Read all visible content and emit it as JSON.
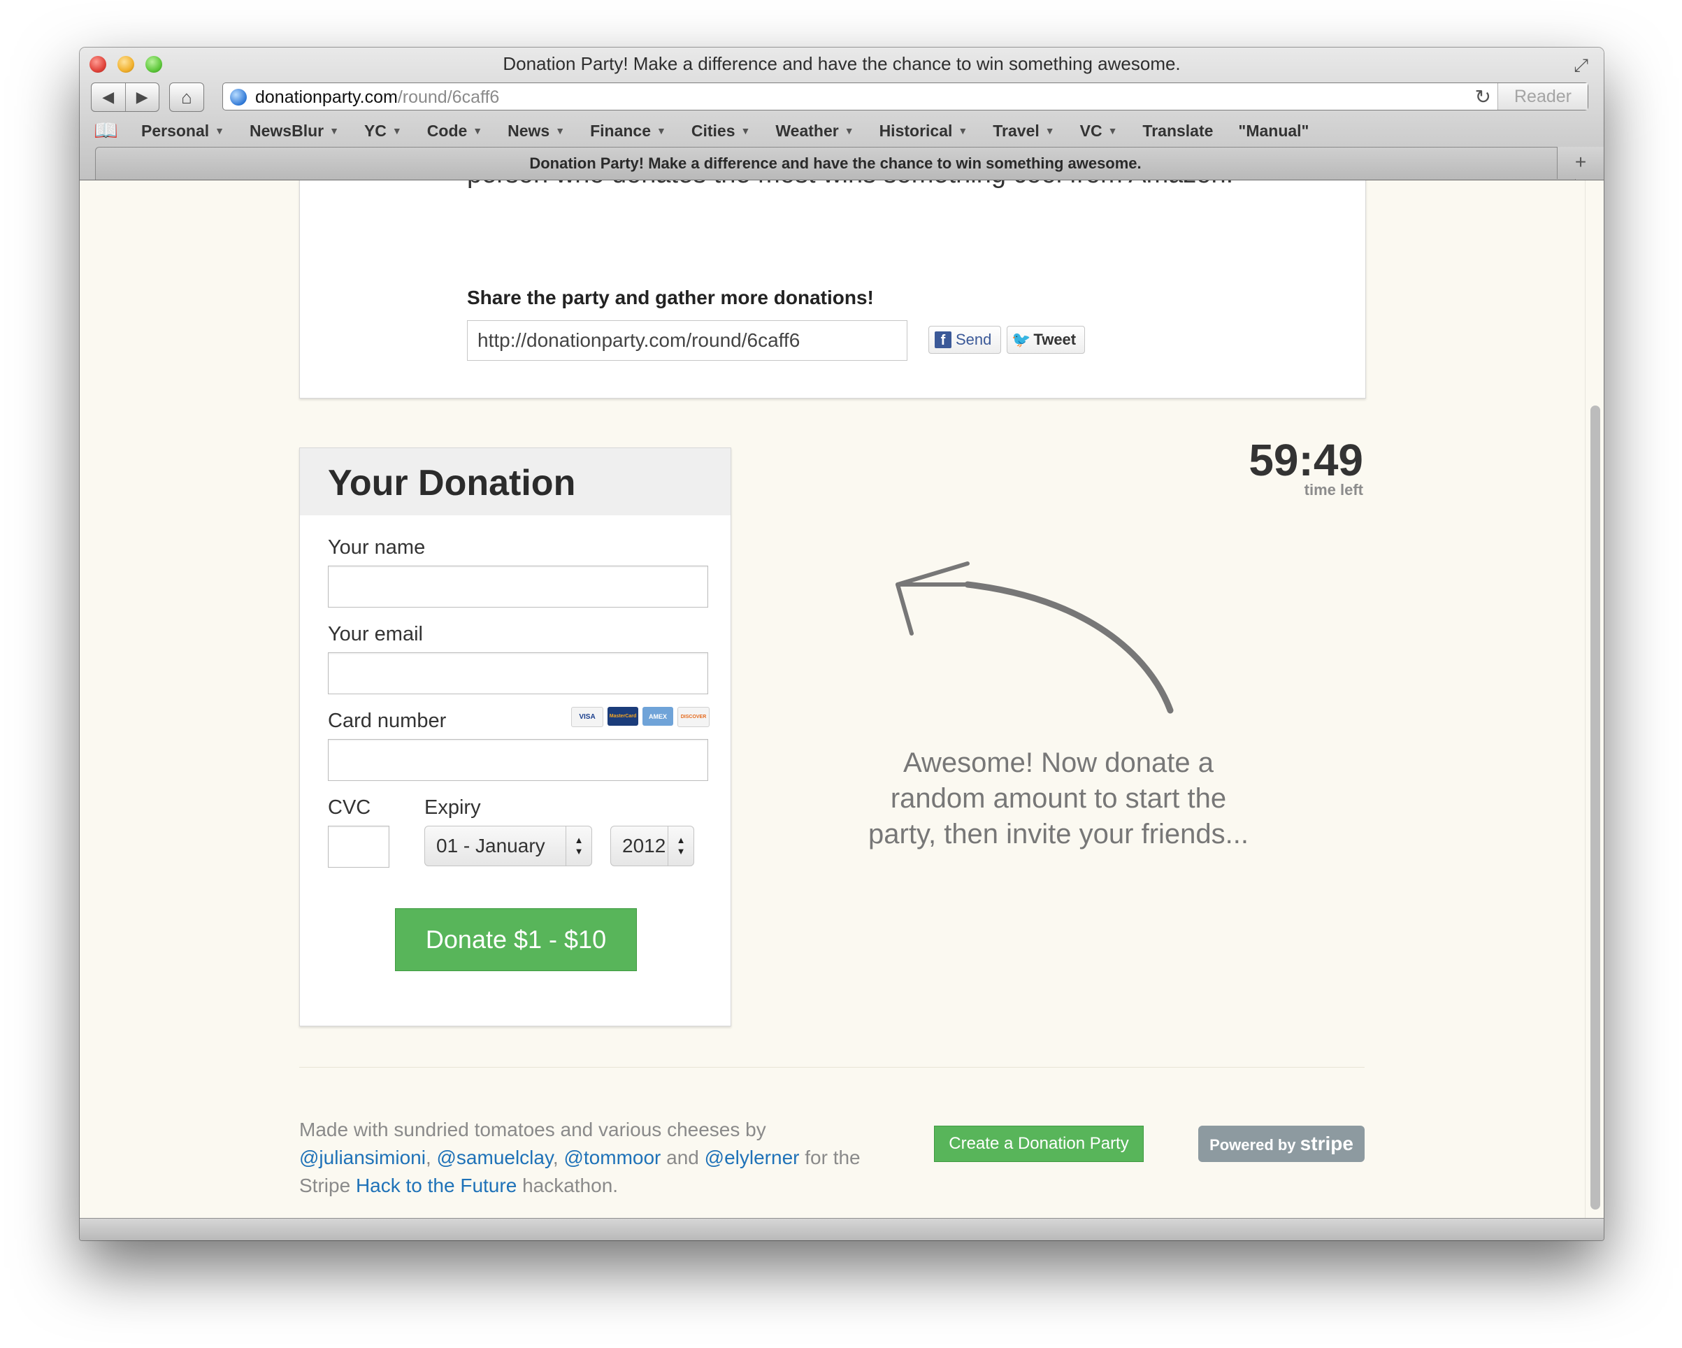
{
  "window": {
    "title": "Donation Party! Make a difference and have the chance to win something awesome."
  },
  "toolbar": {
    "back_icon": "back-arrow-icon",
    "forward_icon": "forward-arrow-icon",
    "home_icon": "home-icon",
    "url_host": "donationparty.com",
    "url_path": "/round/6caff6",
    "reader_label": "Reader"
  },
  "bookmarks": [
    {
      "label": "Personal",
      "dropdown": true
    },
    {
      "label": "NewsBlur",
      "dropdown": true
    },
    {
      "label": "YC",
      "dropdown": true
    },
    {
      "label": "Code",
      "dropdown": true
    },
    {
      "label": "News",
      "dropdown": true
    },
    {
      "label": "Finance",
      "dropdown": true
    },
    {
      "label": "Cities",
      "dropdown": true
    },
    {
      "label": "Weather",
      "dropdown": true
    },
    {
      "label": "Historical",
      "dropdown": true
    },
    {
      "label": "Travel",
      "dropdown": true
    },
    {
      "label": "VC",
      "dropdown": true
    },
    {
      "label": "Translate",
      "dropdown": false
    },
    {
      "label": "\"Manual\"",
      "dropdown": false
    }
  ],
  "tab": {
    "title": "Donation Party! Make a difference and have the chance to win something awesome."
  },
  "share": {
    "cut_text": "person who donates the most wins something cool from Amazon.",
    "heading": "Share the party and gather more donations!",
    "url_value": "http://donationparty.com/round/6caff6",
    "send_label": "Send",
    "tweet_label": "Tweet"
  },
  "donation": {
    "title": "Your Donation",
    "name_label": "Your name",
    "email_label": "Your email",
    "card_label": "Card number",
    "cvc_label": "CVC",
    "expiry_label": "Expiry",
    "month_value": "01 - January",
    "year_value": "2012",
    "card_brands": [
      "VISA",
      "MasterCard",
      "AMEX",
      "DISCOVER"
    ],
    "donate_label": "Donate $1 - $10"
  },
  "timer": {
    "value": "59:49",
    "label": "time left"
  },
  "hint": {
    "line1": "Awesome! Now donate a",
    "line2": "random amount to start the",
    "line3": "party, then invite your friends..."
  },
  "footer": {
    "text1": "Made with sundried tomatoes and various cheeses by",
    "link1": "@juliansimioni",
    "link2": "@samuelclay",
    "link3": "@tommoor",
    "and": "and",
    "link4": "@elylerner",
    "text2": "for the",
    "text3": "Stripe",
    "link5": "Hack to the Future",
    "text4": "hackathon.",
    "create_label": "Create a Donation Party",
    "powered_by": "Powered by",
    "stripe_brand": "stripe"
  },
  "colors": {
    "accent_green": "#58b55a",
    "link_blue": "#1f72b8",
    "page_bg": "#fbf9f1"
  }
}
